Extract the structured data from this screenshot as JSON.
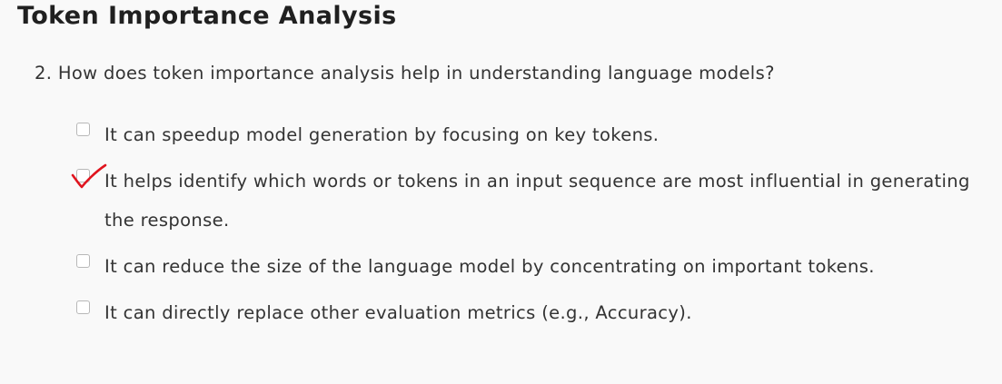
{
  "section": {
    "title": "Token Importance Analysis"
  },
  "question": {
    "text": "2. How does token importance analysis help in understanding language models?"
  },
  "options": [
    {
      "text": "It can speedup model generation by focusing on key tokens.",
      "checked": false
    },
    {
      "text": "It helps identify which words or tokens in an input sequence are most influential in generating the response.",
      "checked": true
    },
    {
      "text": "It can reduce the size of the language model by concentrating on important tokens.",
      "checked": false
    },
    {
      "text": "It can directly replace other evaluation metrics (e.g., Accuracy).",
      "checked": false
    }
  ],
  "colors": {
    "background": "#f9f9f9",
    "text": "#333333",
    "annotation": "#e0141e"
  },
  "icons": {
    "checkbox": "checkbox-icon",
    "annotation": "handwritten-check-icon"
  }
}
